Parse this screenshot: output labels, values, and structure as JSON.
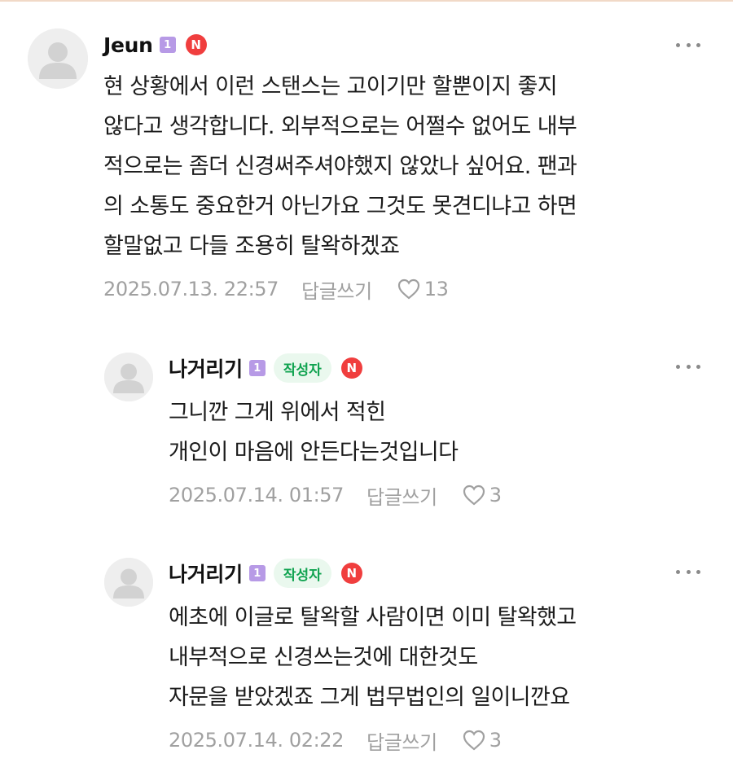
{
  "comments": [
    {
      "nickname": "Jeun",
      "level": "1",
      "is_author": false,
      "new_badge": "N",
      "lines": [
        "현 상황에서 이런 스탠스는 고이기만 할뿐이지 좋지",
        "않다고 생각합니다. 외부적으로는 어쩔수 없어도 내부",
        "적으로는 좀더 신경써주셔야했지 않았나 싶어요. 팬과",
        "의 소통도 중요한거 아닌가요 그것도 못견디냐고 하면",
        "할말없고 다들 조용히 탈왁하겠죠"
      ],
      "date": "2025.07.13. 22:57",
      "reply_label": "답글쓰기",
      "likes": "13"
    },
    {
      "nickname": "나거리기",
      "level": "1",
      "author_label": "작성자",
      "new_badge": "N",
      "lines": [
        "그니깐 그게 위에서 적힌",
        "개인이 마음에 안든다는것입니다"
      ],
      "date": "2025.07.14. 01:57",
      "reply_label": "답글쓰기",
      "likes": "3"
    },
    {
      "nickname": "나거리기",
      "level": "1",
      "author_label": "작성자",
      "new_badge": "N",
      "lines": [
        "에초에 이글로 탈왁할 사람이면 이미 탈왁했고",
        "내부적으로 신경쓰는것에 대한것도",
        "자문을 받았겠죠 그게 법무법인의 일이니깐요"
      ],
      "date": "2025.07.14. 02:22",
      "reply_label": "답글쓰기",
      "likes": "3"
    }
  ],
  "colors": {
    "level_badge": "#b79ae6",
    "author_badge_bg": "#eaf8ee",
    "author_badge_text": "#10a350",
    "new_badge": "#f03e3e",
    "meta_text": "#a0a0a0"
  },
  "icons": [
    "default-avatar-icon",
    "more-options-icon",
    "heart-icon"
  ]
}
